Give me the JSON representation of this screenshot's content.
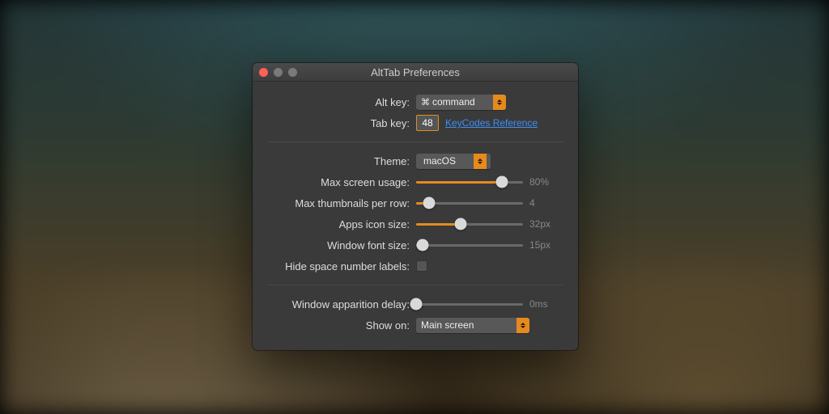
{
  "colors": {
    "accent": "#e58a1f",
    "close": "#ff5f57",
    "min": "#7a7a7a",
    "zoom": "#7a7a7a"
  },
  "title": "AltTab Preferences",
  "section1": {
    "alt_label": "Alt key:",
    "alt_value": "command",
    "tab_label": "Tab key:",
    "tab_value": "48",
    "link": "KeyCodes Reference"
  },
  "section2": {
    "theme_label": "Theme:",
    "theme_value": "macOS",
    "max_screen_label": "Max screen usage:",
    "max_screen_pct": 80,
    "max_screen_text": "80%",
    "thumbs_label": "Max thumbnails per row:",
    "thumbs_pct": 12,
    "thumbs_text": "4",
    "icon_label": "Apps icon size:",
    "icon_pct": 42,
    "icon_text": "32px",
    "font_label": "Window font size:",
    "font_pct": 6,
    "font_text": "15px",
    "hide_label": "Hide space number labels:"
  },
  "section3": {
    "delay_label": "Window apparition delay:",
    "delay_pct": 0,
    "delay_text": "0ms",
    "show_label": "Show on:",
    "show_value": "Main screen"
  }
}
